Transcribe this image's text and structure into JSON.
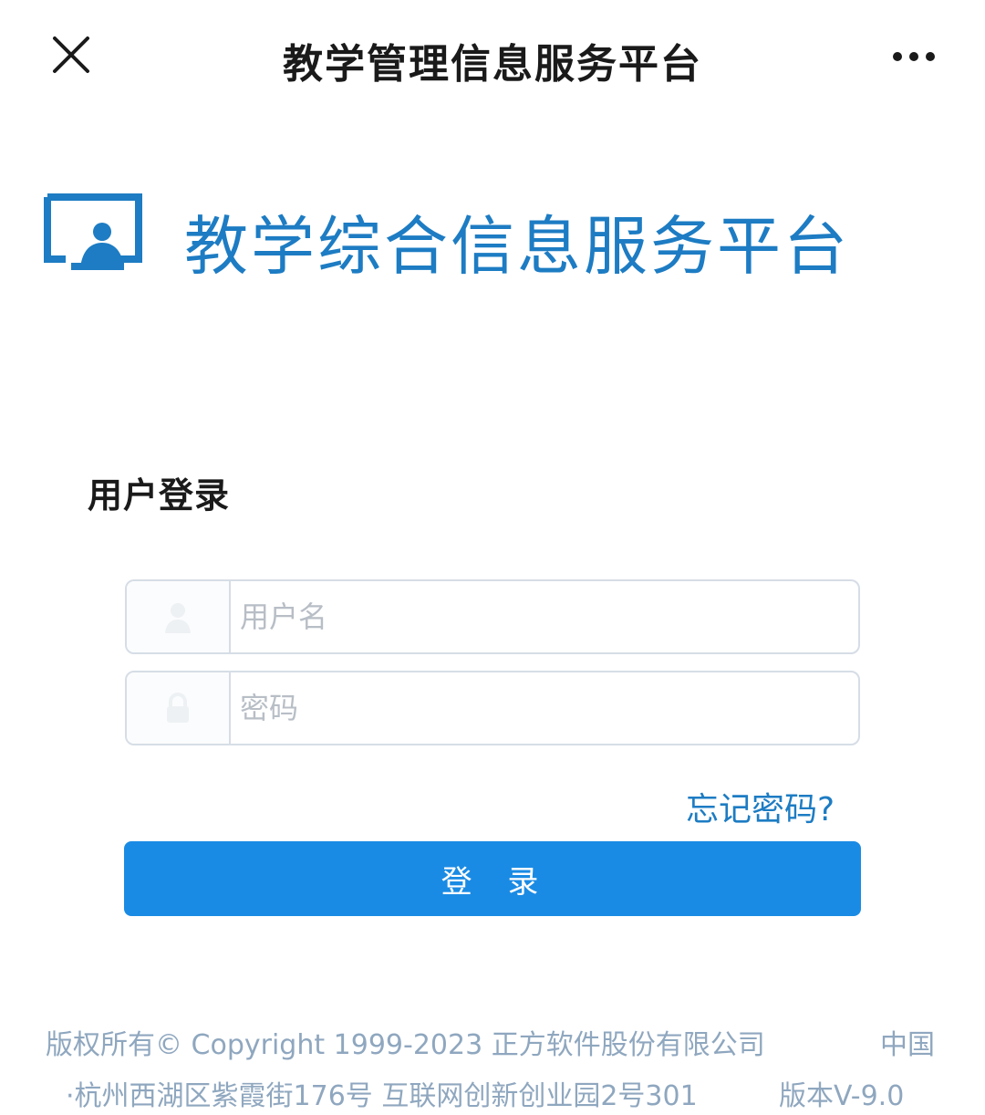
{
  "navbar": {
    "title": "教学管理信息服务平台",
    "close_icon": "close-icon",
    "more_icon": "more-dots-icon"
  },
  "brand": {
    "title": "教学综合信息服务平台",
    "logo_icon": "screen-user-logo-icon",
    "color": "#1d7cc3"
  },
  "login": {
    "section_title": "用户登录",
    "username": {
      "placeholder": "用户名",
      "value": "",
      "icon": "user-icon"
    },
    "password": {
      "placeholder": "密码",
      "value": "",
      "icon": "lock-icon"
    },
    "forgot_password": "忘记密码?",
    "submit_label": "登 录",
    "button_color": "#1a8be4"
  },
  "footer": {
    "copyright": "版权所有© Copyright 1999-2023 正方软件股份有限公司",
    "country": "中国",
    "address": "·杭州西湖区紫霞街176号 互联网创新创业园2号301",
    "version": "版本V-9.0"
  }
}
